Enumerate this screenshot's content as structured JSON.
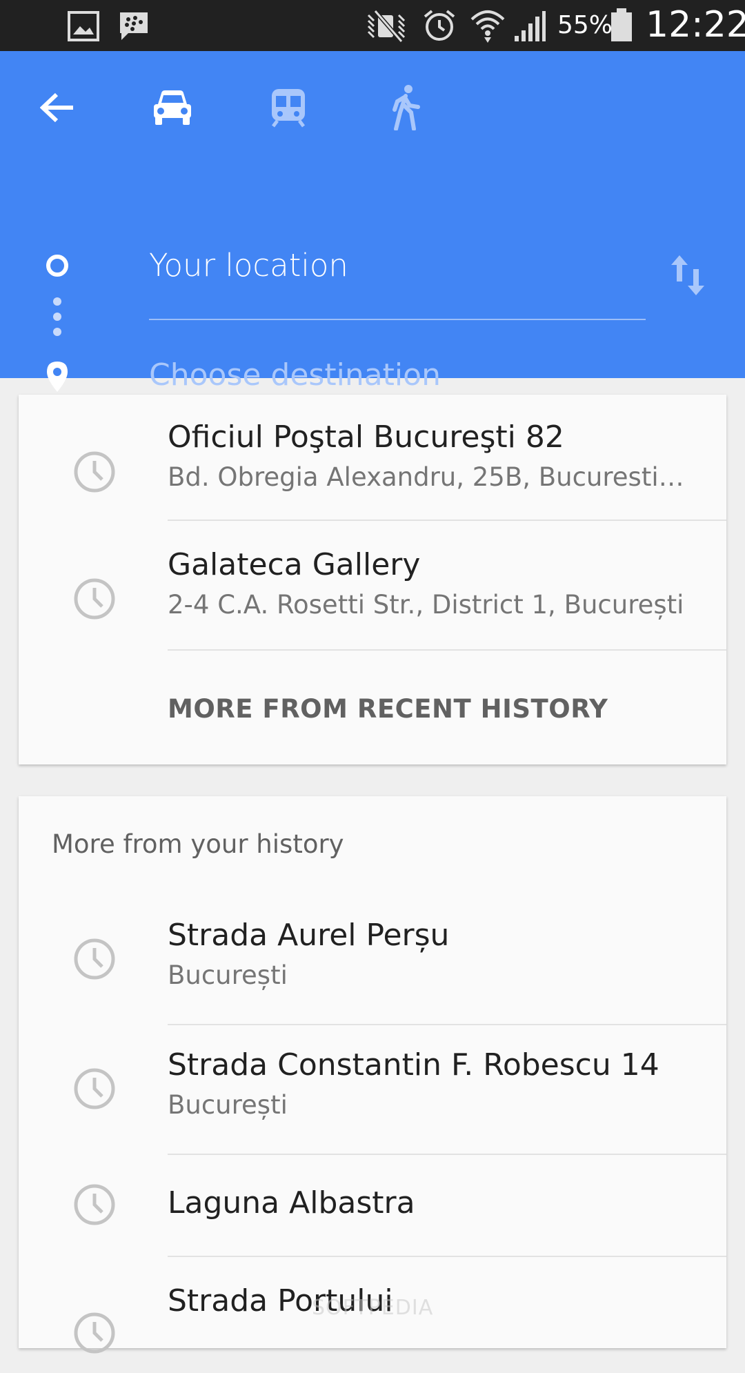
{
  "status_bar": {
    "battery": "55%",
    "time": "12:22",
    "icons": [
      "gallery-icon",
      "bbm-icon",
      "mute-icon",
      "alarm-icon",
      "wifi-icon",
      "signal-icon",
      "battery-icon"
    ]
  },
  "header": {
    "icons": [
      "back-arrow-icon",
      "car-icon",
      "transit-icon",
      "walk-icon",
      "swap-icon"
    ],
    "origin_text": "Your location",
    "destination_placeholder": "Choose destination",
    "colors": {
      "background": "#4285f4",
      "placeholder": "#a9c7fb"
    }
  },
  "recent": {
    "items": [
      {
        "title": "Oficiul Poştal Bucureşti 82",
        "subtitle": "Bd. Obregia Alexandru, 25B, Bucuresti…"
      },
      {
        "title": "Galateca Gallery",
        "subtitle": "2-4 C.A. Rosetti Str., District 1, București"
      }
    ],
    "more_label": "MORE FROM RECENT HISTORY"
  },
  "history": {
    "section_title": "More from your history",
    "items": [
      {
        "title": "Strada Aurel Perșu",
        "subtitle": "București"
      },
      {
        "title": "Strada Constantin F. Robescu 14",
        "subtitle": "București"
      },
      {
        "title": "Laguna Albastra",
        "subtitle": ""
      },
      {
        "title": "Strada Portului",
        "subtitle": ""
      }
    ]
  },
  "watermark": "SOFTPEDIA"
}
